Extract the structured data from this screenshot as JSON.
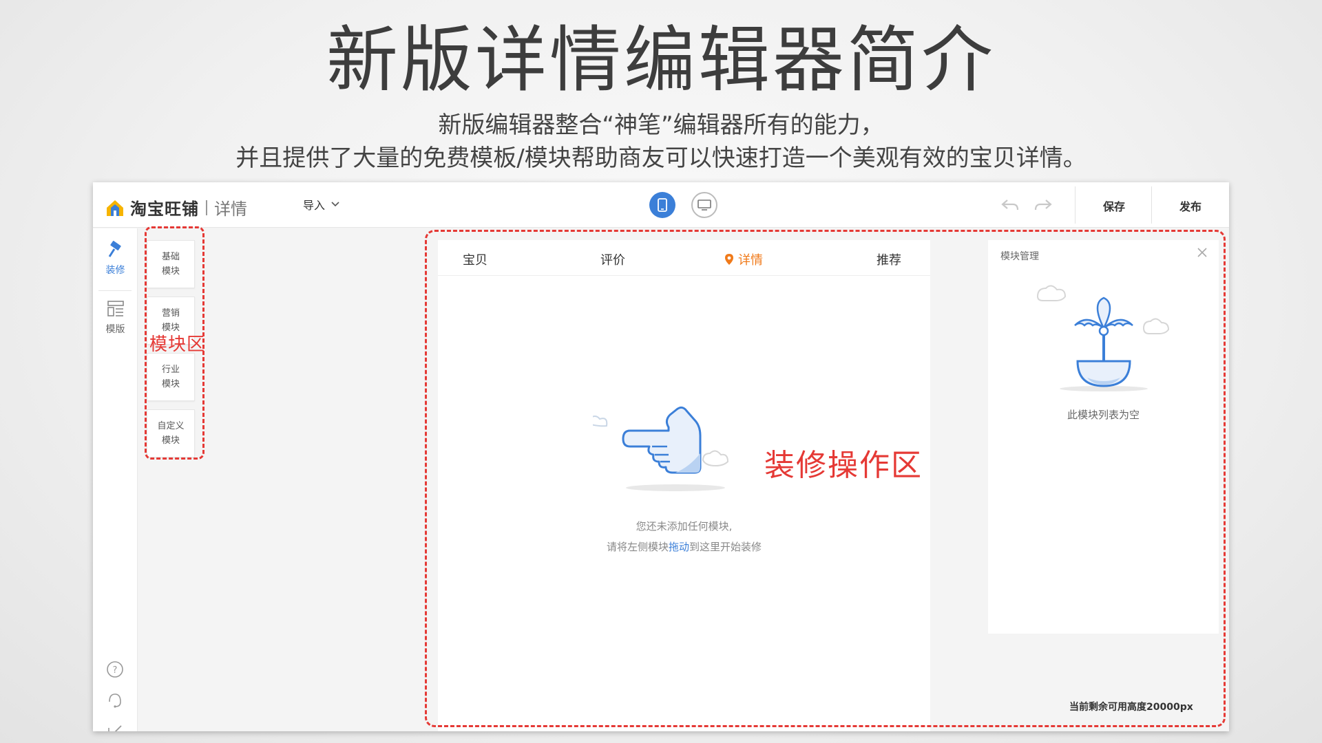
{
  "slide": {
    "title": "新版详情编辑器简介",
    "subtitle_line1": "新版编辑器整合“神笔”编辑器所有的能力，",
    "subtitle_line2": "并且提供了大量的免费模板/模块帮助商友可以快速打造一个美观有效的宝贝详情。"
  },
  "header": {
    "app_name": "淘宝旺铺",
    "app_section": "详情",
    "import_label": "导入",
    "save_label": "保存",
    "publish_label": "发布",
    "view_mode_active": "mobile"
  },
  "leftnav": {
    "items": [
      {
        "label": "装修",
        "icon": "hammer-icon",
        "active": true
      },
      {
        "label": "模版",
        "icon": "template-layout-icon",
        "active": false
      }
    ],
    "bottom_icons": [
      "help-icon",
      "headset-icon",
      "edit-icon"
    ]
  },
  "modules": {
    "buttons": [
      {
        "line1": "基础",
        "line2": "模块"
      },
      {
        "line1": "营销",
        "line2": "模块"
      },
      {
        "line1": "行业",
        "line2": "模块"
      },
      {
        "line1": "自定义",
        "line2": "模块"
      }
    ],
    "area_label": "模块区"
  },
  "canvas": {
    "tabs": [
      "宝贝",
      "评价",
      "详情",
      "推荐"
    ],
    "active_tab": "详情",
    "empty_line1": "您还未添加任何模块,",
    "empty_line2_prefix": "请将左侧模块",
    "empty_line2_link": "拖动",
    "empty_line2_suffix": "到这里开始装修",
    "area_label": "装修操作区"
  },
  "right_panel": {
    "title": "模块管理",
    "empty_text": "此模块列表为空"
  },
  "footer": {
    "remaining_height": "当前剩余可用高度20000px"
  },
  "colors": {
    "accent_blue": "#3b7fd8",
    "active_tab_orange": "#f07a1a",
    "annotation_red": "#e53935"
  }
}
